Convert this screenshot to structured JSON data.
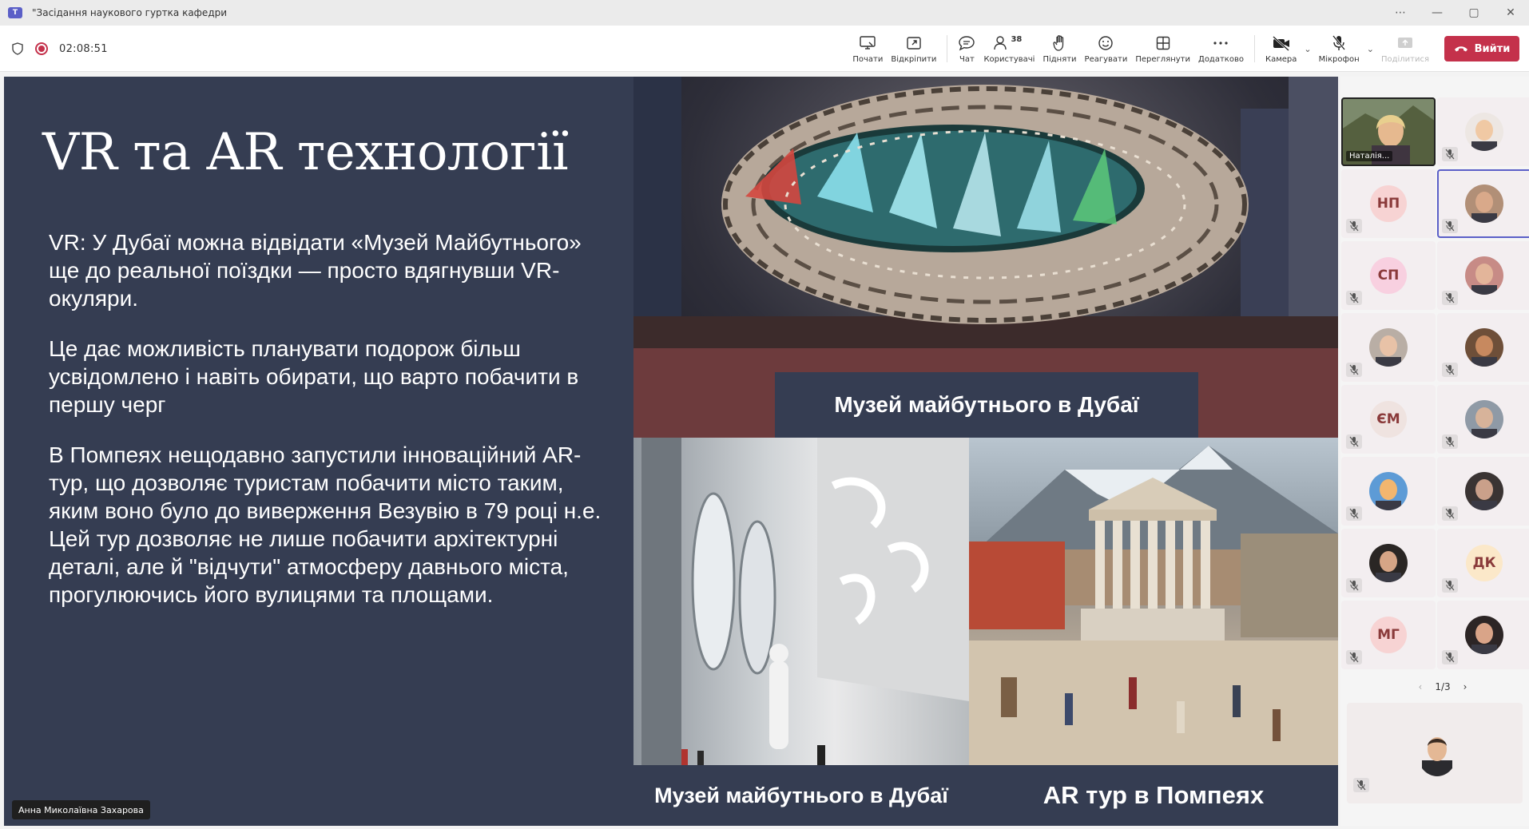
{
  "window": {
    "title": "\"Засідання наукового гуртка кафедри",
    "more": "⋯",
    "minimize": "—",
    "maximize": "▢",
    "close": "✕"
  },
  "meeting": {
    "timer": "02:08:51"
  },
  "toolbar": {
    "items": [
      {
        "id": "start",
        "label": "Почати"
      },
      {
        "id": "unpin",
        "label": "Відкріпити"
      },
      {
        "id": "chat",
        "label": "Чат"
      },
      {
        "id": "users",
        "label": "Користувачі",
        "count": "38"
      },
      {
        "id": "raise",
        "label": "Підняти"
      },
      {
        "id": "react",
        "label": "Реагувати"
      },
      {
        "id": "view",
        "label": "Переглянути"
      },
      {
        "id": "more",
        "label": "Додатково"
      },
      {
        "id": "camera",
        "label": "Камера"
      },
      {
        "id": "mic",
        "label": "Мікрофон"
      },
      {
        "id": "share",
        "label": "Поділитися"
      }
    ],
    "leave_label": "Вийти"
  },
  "slide": {
    "title": "VR та AR технології",
    "paragraphs": [
      "VR: У Дубаї можна відвідати «Музей Майбутнього» ще до реальної поїздки — просто вдягнувши VR-окуляри.",
      "Це дає можливість планувати подорож більш усвідомлено і навіть обирати, що варто побачити в першу черг",
      "В Помпеях нещодавно запустили інноваційний AR-тур, що дозволяє туристам побачити місто таким, яким воно було до виверження Везувію в 79 році н.е. Цей тур дозволяє не лише побачити архітектурні деталі, але й \"відчути\" атмосферу давнього міста, прогулюючись його вулицями та площами."
    ],
    "captions": {
      "top": "Музей майбутнього в Дубаї",
      "bottom_left": "Музей майбутнього в Дубаї",
      "bottom_right": "AR тур в Помпеях"
    }
  },
  "presenter": {
    "name": "Анна Миколаївна Захарова"
  },
  "participants": {
    "tiles": [
      {
        "kind": "video",
        "name": "Наталія...",
        "skin": "#e6b98f",
        "bg": "#7c8a6c"
      },
      {
        "kind": "photo",
        "skin": "#f0c9a4",
        "bg": "#ede7e3"
      },
      {
        "kind": "initials",
        "initials": "НП",
        "color": "#f7d3d3"
      },
      {
        "kind": "photo",
        "skin": "#d9a98a",
        "bg": "#b18f77"
      },
      {
        "kind": "initials",
        "initials": "СП",
        "color": "#f8d0e0"
      },
      {
        "kind": "photo",
        "skin": "#e3b59a",
        "bg": "#c78b86"
      },
      {
        "kind": "photo",
        "skin": "#e8c2a7",
        "bg": "#b9aea5"
      },
      {
        "kind": "photo",
        "skin": "#c7895f",
        "bg": "#6e4f39"
      },
      {
        "kind": "initials",
        "initials": "ЄМ",
        "color": "#efe3e0"
      },
      {
        "kind": "photo",
        "skin": "#d7b39a",
        "bg": "#8f9aa6"
      },
      {
        "kind": "photo",
        "skin": "#f2b66f",
        "bg": "#5d9bd6"
      },
      {
        "kind": "photo",
        "skin": "#caa08a",
        "bg": "#3a3433"
      },
      {
        "kind": "photo",
        "skin": "#d6a586",
        "bg": "#2a2624"
      },
      {
        "kind": "initials",
        "initials": "ДК",
        "color": "#fbe8c9"
      },
      {
        "kind": "initials",
        "initials": "МГ",
        "color": "#f7d3d3"
      },
      {
        "kind": "photo",
        "skin": "#d9a488",
        "bg": "#2c2525"
      }
    ],
    "page": "1/3",
    "prev": "‹",
    "next": "›",
    "self_tile": {
      "skin": "#e4b895",
      "bg": "#f1ecec"
    }
  }
}
